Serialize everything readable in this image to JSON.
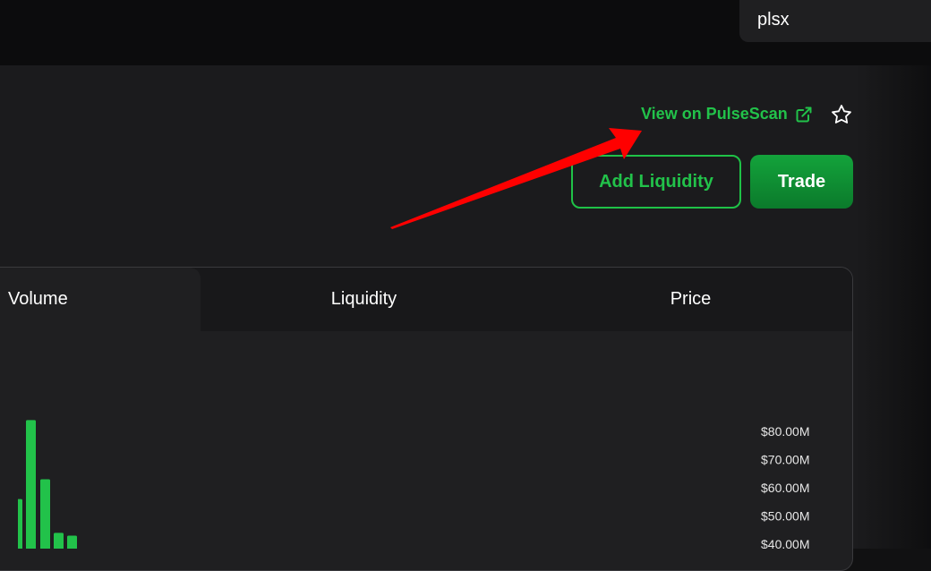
{
  "header": {
    "search_value": "plsx"
  },
  "token_actions": {
    "explorer_link_label": "View on PulseScan",
    "add_liquidity_label": "Add Liquidity",
    "trade_label": "Trade"
  },
  "chart_tabs": [
    {
      "label": "Volume",
      "active": true
    },
    {
      "label": "Liquidity",
      "active": false
    },
    {
      "label": "Price",
      "active": false
    }
  ],
  "colors": {
    "accent": "#22c24a",
    "background": "#1b1b1d",
    "annotation_arrow": "#ff0000"
  },
  "chart_data": {
    "type": "bar",
    "title": "",
    "xlabel": "",
    "ylabel": "",
    "y_tick_labels": [
      "$80.00M",
      "$70.00M",
      "$60.00M",
      "$50.00M",
      "$40.00M"
    ],
    "y_ticks": [
      80,
      70,
      60,
      50,
      40
    ],
    "values": [
      56,
      84,
      63,
      44,
      43
    ],
    "series": [
      {
        "values": [
          56,
          84,
          63,
          44,
          43
        ]
      }
    ]
  }
}
